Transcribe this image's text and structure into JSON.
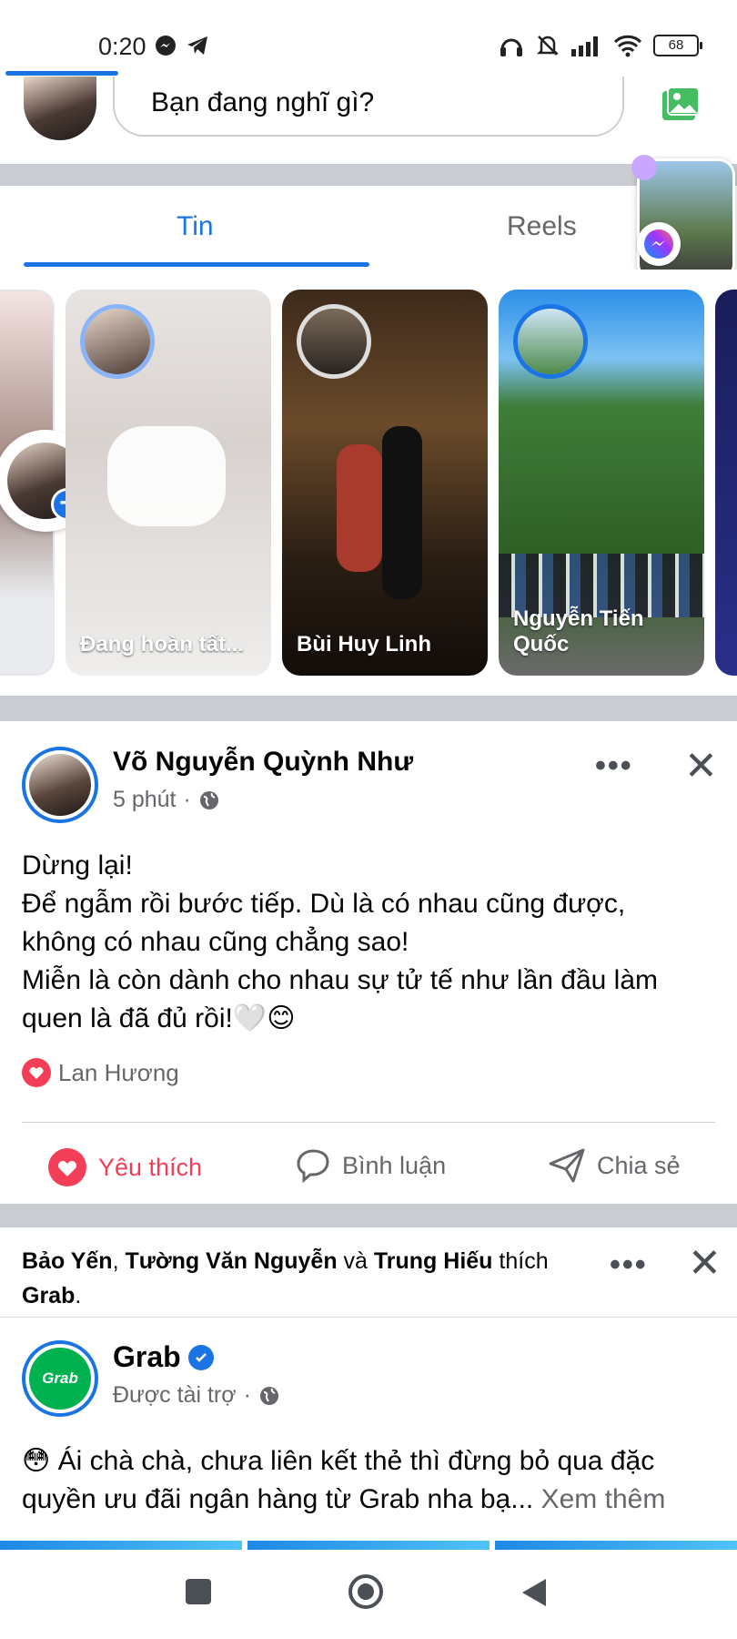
{
  "status_bar": {
    "time": "0:20",
    "battery": "68",
    "icons": [
      "messenger-icon",
      "telegram-icon",
      "headphones-icon",
      "bell-muted-icon",
      "signal-icon",
      "wifi-icon",
      "battery-icon"
    ]
  },
  "composer": {
    "placeholder": "Bạn đang nghĩ gì?",
    "photo_icon": "photo-icon"
  },
  "tabs": [
    {
      "label": "Tin",
      "active": true
    },
    {
      "label": "Reels",
      "active": false
    }
  ],
  "stories": [
    {
      "name": "Đang hoàn tất..."
    },
    {
      "name": "Bùi Huy Linh"
    },
    {
      "name": "Nguyễn Tiến Quốc",
      "line1": "Nguyễn Tiến",
      "line2": "Quốc"
    }
  ],
  "post1": {
    "author": "Võ Nguyễn Quỳnh Như",
    "time": "5 phút",
    "lines": [
      "Dừng lại!",
      "Để ngẫm rồi bước tiếp. Dù là có nhau cũng được,",
      "không có nhau cũng chẳng sao!",
      "Miễn là còn dành cho nhau sự tử tế như lần đầu làm",
      "quen là đã đủ rồi!🤍😊"
    ],
    "reactor": "Lan Hương",
    "actions": {
      "like": "Yêu thích",
      "comment": "Bình luận",
      "share": "Chia sẻ"
    }
  },
  "post2": {
    "social": {
      "name1": "Bảo Yến",
      "sep1": ", ",
      "name2": "Tường Văn Nguyễn",
      "sep2": " và ",
      "name3": "Trung Hiếu",
      "verb": " thích",
      "page": "Grab",
      "end": "."
    },
    "page_name": "Grab",
    "logo_text": "Grab",
    "meta": "Được tài trợ",
    "text": "😳 Ái chà chà, chưa liên kết thẻ thì đừng bỏ qua đặc quyền ưu đãi ngân hàng từ Grab nha bạ...",
    "see_more": "Xem thêm"
  },
  "colors": {
    "accent": "#1b74e4",
    "like": "#f33e58",
    "grab": "#00b14f",
    "separator": "#c9ccd1"
  }
}
